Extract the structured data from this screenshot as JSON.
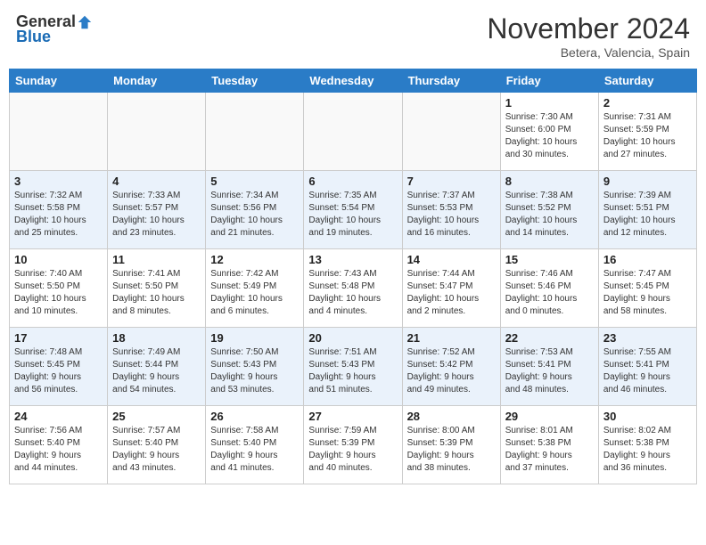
{
  "header": {
    "logo_general": "General",
    "logo_blue": "Blue",
    "month_title": "November 2024",
    "location": "Betera, Valencia, Spain"
  },
  "weekdays": [
    "Sunday",
    "Monday",
    "Tuesday",
    "Wednesday",
    "Thursday",
    "Friday",
    "Saturday"
  ],
  "weeks": [
    [
      {
        "day": "",
        "info": ""
      },
      {
        "day": "",
        "info": ""
      },
      {
        "day": "",
        "info": ""
      },
      {
        "day": "",
        "info": ""
      },
      {
        "day": "",
        "info": ""
      },
      {
        "day": "1",
        "info": "Sunrise: 7:30 AM\nSunset: 6:00 PM\nDaylight: 10 hours\nand 30 minutes."
      },
      {
        "day": "2",
        "info": "Sunrise: 7:31 AM\nSunset: 5:59 PM\nDaylight: 10 hours\nand 27 minutes."
      }
    ],
    [
      {
        "day": "3",
        "info": "Sunrise: 7:32 AM\nSunset: 5:58 PM\nDaylight: 10 hours\nand 25 minutes."
      },
      {
        "day": "4",
        "info": "Sunrise: 7:33 AM\nSunset: 5:57 PM\nDaylight: 10 hours\nand 23 minutes."
      },
      {
        "day": "5",
        "info": "Sunrise: 7:34 AM\nSunset: 5:56 PM\nDaylight: 10 hours\nand 21 minutes."
      },
      {
        "day": "6",
        "info": "Sunrise: 7:35 AM\nSunset: 5:54 PM\nDaylight: 10 hours\nand 19 minutes."
      },
      {
        "day": "7",
        "info": "Sunrise: 7:37 AM\nSunset: 5:53 PM\nDaylight: 10 hours\nand 16 minutes."
      },
      {
        "day": "8",
        "info": "Sunrise: 7:38 AM\nSunset: 5:52 PM\nDaylight: 10 hours\nand 14 minutes."
      },
      {
        "day": "9",
        "info": "Sunrise: 7:39 AM\nSunset: 5:51 PM\nDaylight: 10 hours\nand 12 minutes."
      }
    ],
    [
      {
        "day": "10",
        "info": "Sunrise: 7:40 AM\nSunset: 5:50 PM\nDaylight: 10 hours\nand 10 minutes."
      },
      {
        "day": "11",
        "info": "Sunrise: 7:41 AM\nSunset: 5:50 PM\nDaylight: 10 hours\nand 8 minutes."
      },
      {
        "day": "12",
        "info": "Sunrise: 7:42 AM\nSunset: 5:49 PM\nDaylight: 10 hours\nand 6 minutes."
      },
      {
        "day": "13",
        "info": "Sunrise: 7:43 AM\nSunset: 5:48 PM\nDaylight: 10 hours\nand 4 minutes."
      },
      {
        "day": "14",
        "info": "Sunrise: 7:44 AM\nSunset: 5:47 PM\nDaylight: 10 hours\nand 2 minutes."
      },
      {
        "day": "15",
        "info": "Sunrise: 7:46 AM\nSunset: 5:46 PM\nDaylight: 10 hours\nand 0 minutes."
      },
      {
        "day": "16",
        "info": "Sunrise: 7:47 AM\nSunset: 5:45 PM\nDaylight: 9 hours\nand 58 minutes."
      }
    ],
    [
      {
        "day": "17",
        "info": "Sunrise: 7:48 AM\nSunset: 5:45 PM\nDaylight: 9 hours\nand 56 minutes."
      },
      {
        "day": "18",
        "info": "Sunrise: 7:49 AM\nSunset: 5:44 PM\nDaylight: 9 hours\nand 54 minutes."
      },
      {
        "day": "19",
        "info": "Sunrise: 7:50 AM\nSunset: 5:43 PM\nDaylight: 9 hours\nand 53 minutes."
      },
      {
        "day": "20",
        "info": "Sunrise: 7:51 AM\nSunset: 5:43 PM\nDaylight: 9 hours\nand 51 minutes."
      },
      {
        "day": "21",
        "info": "Sunrise: 7:52 AM\nSunset: 5:42 PM\nDaylight: 9 hours\nand 49 minutes."
      },
      {
        "day": "22",
        "info": "Sunrise: 7:53 AM\nSunset: 5:41 PM\nDaylight: 9 hours\nand 48 minutes."
      },
      {
        "day": "23",
        "info": "Sunrise: 7:55 AM\nSunset: 5:41 PM\nDaylight: 9 hours\nand 46 minutes."
      }
    ],
    [
      {
        "day": "24",
        "info": "Sunrise: 7:56 AM\nSunset: 5:40 PM\nDaylight: 9 hours\nand 44 minutes."
      },
      {
        "day": "25",
        "info": "Sunrise: 7:57 AM\nSunset: 5:40 PM\nDaylight: 9 hours\nand 43 minutes."
      },
      {
        "day": "26",
        "info": "Sunrise: 7:58 AM\nSunset: 5:40 PM\nDaylight: 9 hours\nand 41 minutes."
      },
      {
        "day": "27",
        "info": "Sunrise: 7:59 AM\nSunset: 5:39 PM\nDaylight: 9 hours\nand 40 minutes."
      },
      {
        "day": "28",
        "info": "Sunrise: 8:00 AM\nSunset: 5:39 PM\nDaylight: 9 hours\nand 38 minutes."
      },
      {
        "day": "29",
        "info": "Sunrise: 8:01 AM\nSunset: 5:38 PM\nDaylight: 9 hours\nand 37 minutes."
      },
      {
        "day": "30",
        "info": "Sunrise: 8:02 AM\nSunset: 5:38 PM\nDaylight: 9 hours\nand 36 minutes."
      }
    ]
  ]
}
